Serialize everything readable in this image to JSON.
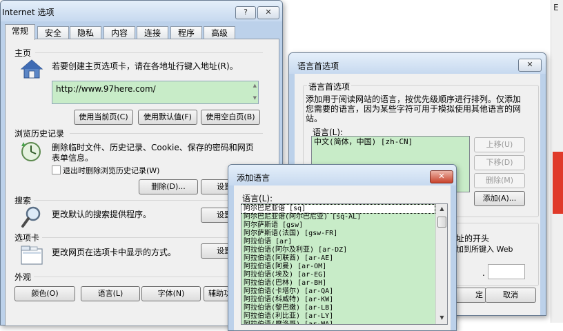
{
  "background_window": {
    "right_fragment_text": "E"
  },
  "internet_options": {
    "title": "Internet 选项",
    "help_button": "?",
    "close_button": "✕",
    "tabs": [
      "常规",
      "安全",
      "隐私",
      "内容",
      "连接",
      "程序",
      "高级"
    ],
    "homepage": {
      "heading": "主页",
      "description": "若要创建主页选项卡，请在各地址行键入地址(R)。",
      "url": "http://www.97here.com/",
      "buttons": {
        "use_current": "使用当前页(C)",
        "use_default": "使用默认值(F)",
        "use_blank": "使用空白页(B)"
      }
    },
    "history": {
      "heading": "浏览历史记录",
      "description_line1": "删除临时文件、历史记录、Cookie、保存的密码和网页",
      "description_line2": "表单信息。",
      "checkbox_label": "退出时删除浏览历史记录(W)",
      "delete_button": "删除(D)...",
      "settings_button": "设置"
    },
    "search": {
      "heading": "搜索",
      "description": "更改默认的搜索提供程序。",
      "settings_button": "设置"
    },
    "tabs_section": {
      "heading": "选项卡",
      "description": "更改网页在选项卡中显示的方式。",
      "settings_button": "设置"
    },
    "appearance": {
      "heading": "外观",
      "colors_button": "颜色(O)",
      "languages_button": "语言(L)",
      "fonts_button": "字体(N)",
      "accessibility_button": "辅助功"
    }
  },
  "language_preference": {
    "title": "语言首选项",
    "close_button": "✕",
    "group_title": "语言首选项",
    "description_line1": "添加用于阅读网站的语言，按优先级顺序进行排列。仅添加",
    "description_line2": "您需要的语言，因为某些字符可用于模拟使用其他语言的网",
    "description_line3": "站。",
    "list_label": "语言(L):",
    "languages": [
      "中文(简体，中国) [zh-CN]"
    ],
    "buttons": {
      "move_up": "上移(U)",
      "move_down": "下移(D)",
      "remove": "删除(M)",
      "add": "添加(A)..."
    },
    "partial_line1": "址的开头",
    "partial_line2": "加到所键入 Web",
    "partial_field_dot": ".",
    "ok_fragment": "定",
    "cancel_button": "取消"
  },
  "add_language": {
    "title": "添加语言",
    "close_button": "✕",
    "list_label": "语言(L):",
    "languages": [
      "阿尔巴尼亚语 [sq]",
      "阿尔巴尼亚语(阿尔巴尼亚) [sq-AL]",
      "阿尔萨斯语 [gsw]",
      "阿尔萨斯语(法国) [gsw-FR]",
      "阿拉伯语 [ar]",
      "阿拉伯语(阿尔及利亚) [ar-DZ]",
      "阿拉伯语(阿联酋) [ar-AE]",
      "阿拉伯语(阿曼) [ar-OM]",
      "阿拉伯语(埃及) [ar-EG]",
      "阿拉伯语(巴林) [ar-BH]",
      "阿拉伯语(卡塔尔) [ar-QA]",
      "阿拉伯语(科威特) [ar-KW]",
      "阿拉伯语(黎巴嫩) [ar-LB]",
      "阿拉伯语(利比亚) [ar-LY]",
      "阿拉伯语(摩洛哥) [ar-MA]"
    ],
    "selected_index": 0,
    "scroll_up": "▲",
    "scroll_down": "▼"
  }
}
